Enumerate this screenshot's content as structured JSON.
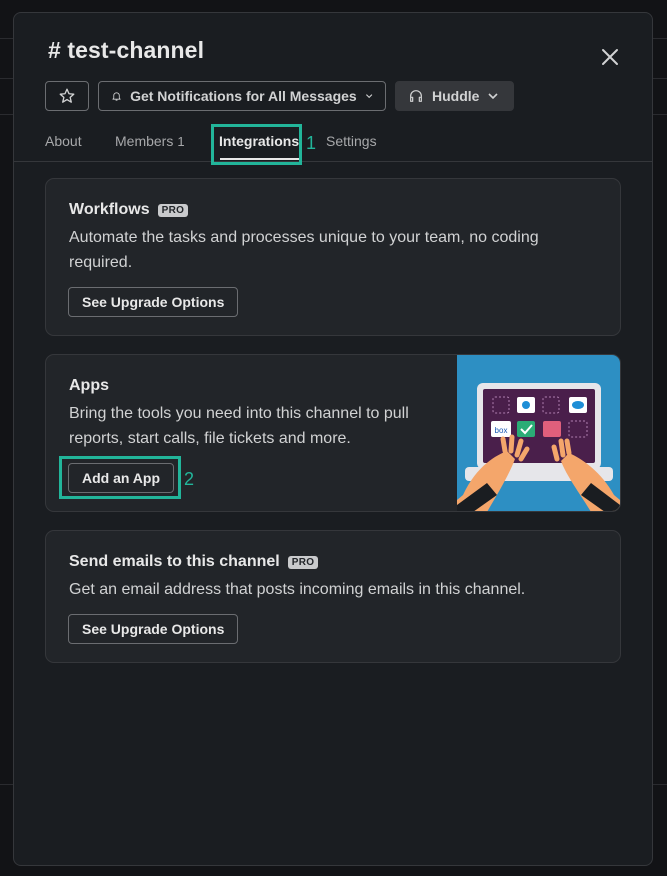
{
  "header": {
    "title": "# test-channel",
    "notifications_label": "Get Notifications for All Messages",
    "huddle_label": "Huddle"
  },
  "tabs": [
    {
      "label": "About"
    },
    {
      "label": "Members",
      "count": "1"
    },
    {
      "label": "Integrations"
    },
    {
      "label": "Settings"
    }
  ],
  "annotations": {
    "tab_marker": "1",
    "add_app_marker": "2"
  },
  "cards": {
    "workflows": {
      "title": "Workflows",
      "badge": "PRO",
      "description": "Automate the tasks and processes unique to your team, no coding required.",
      "button": "See Upgrade Options"
    },
    "apps": {
      "title": "Apps",
      "description": "Bring the tools you need into this channel to pull reports, start calls, file tickets and more.",
      "button": "Add an App",
      "illustration_text": "box"
    },
    "emails": {
      "title": "Send emails to this channel",
      "badge": "PRO",
      "description": "Get an email address that posts incoming emails in this channel.",
      "button": "See Upgrade Options"
    }
  },
  "colors": {
    "modal_bg": "#1a1d21",
    "card_bg": "#222529",
    "highlight": "#22b59a",
    "illustration_bg": "#2d8fc3"
  }
}
